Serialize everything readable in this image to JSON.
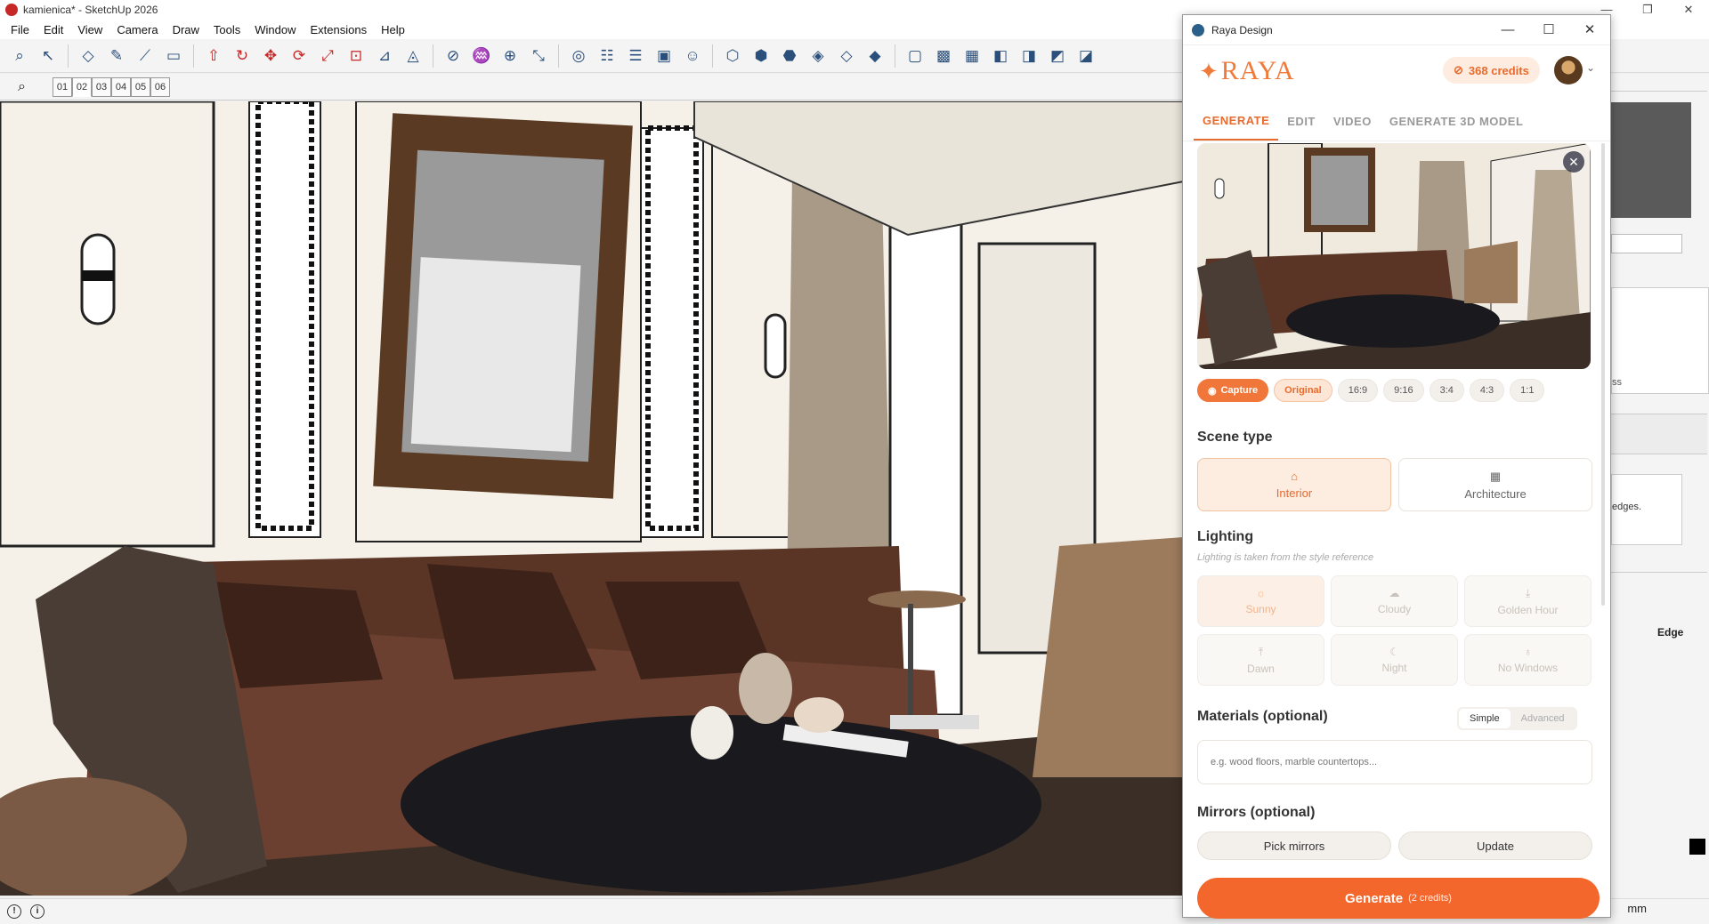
{
  "window": {
    "title": "kamienica* - SketchUp 2026",
    "controls": [
      "—",
      "❐",
      "✕"
    ]
  },
  "menu": [
    "File",
    "Edit",
    "View",
    "Camera",
    "Draw",
    "Tools",
    "Window",
    "Extensions",
    "Help"
  ],
  "toolbar": {
    "icons": [
      "search-icon",
      "select-icon",
      "eraser-icon",
      "pencil-icon",
      "line-icon",
      "rectangle-icon",
      "push-pull-icon",
      "follow-me-icon",
      "move-icon",
      "rotate-icon",
      "scale-icon",
      "offset-icon",
      "tape-measure-icon",
      "protractor-icon",
      "section-icon",
      "paint-icon",
      "zoom-icon",
      "zoom-extents-icon",
      "components-icon",
      "styles-icon",
      "layers-icon",
      "scenes-icon",
      "user-icon",
      "iso-view-icon",
      "top-view-icon",
      "front-view-icon",
      "right-view-icon",
      "back-view-icon",
      "left-view-icon",
      "wireframe-icon",
      "shaded-icon",
      "textured-icon",
      "monochrome-icon",
      "xray-icon",
      "backedges-icon",
      "hidden-line-icon"
    ]
  },
  "scenes": {
    "tabs": [
      "01",
      "02",
      "03",
      "04",
      "05",
      "06"
    ],
    "active": "02"
  },
  "status": {
    "units": "mm",
    "edge_label": "Edge",
    "tray_text_1": "ss",
    "tray_text_2": "edges."
  },
  "raya": {
    "window_title": "Raya Design",
    "logo": "RAYA",
    "credits": "368 credits",
    "tabs": [
      "GENERATE",
      "EDIT",
      "VIDEO",
      "GENERATE 3D MODEL"
    ],
    "active_tab": "GENERATE",
    "capture_label": "Capture",
    "ratios": [
      "Original",
      "16:9",
      "9:16",
      "3:4",
      "4:3",
      "1:1"
    ],
    "selected_ratio": "Original",
    "scene_type": {
      "title": "Scene type",
      "options": [
        "Interior",
        "Architecture"
      ],
      "selected": "Interior"
    },
    "lighting": {
      "title": "Lighting",
      "note": "Lighting is taken from the style reference",
      "options": [
        "Sunny",
        "Cloudy",
        "Golden Hour",
        "Dawn",
        "Night",
        "No Windows"
      ],
      "selected": "Sunny"
    },
    "materials": {
      "title": "Materials (optional)",
      "modes": [
        "Simple",
        "Advanced"
      ],
      "selected_mode": "Simple",
      "placeholder": "e.g. wood floors, marble countertops..."
    },
    "mirrors": {
      "title": "Mirrors (optional)",
      "pick_label": "Pick mirrors",
      "update_label": "Update"
    },
    "generate": {
      "label": "Generate",
      "cost": "(2 credits)"
    }
  },
  "colors": {
    "accent": "#f4672c",
    "accent_light": "#fdece0",
    "sofa": "#5a3526",
    "wall": "#f4efe6"
  }
}
